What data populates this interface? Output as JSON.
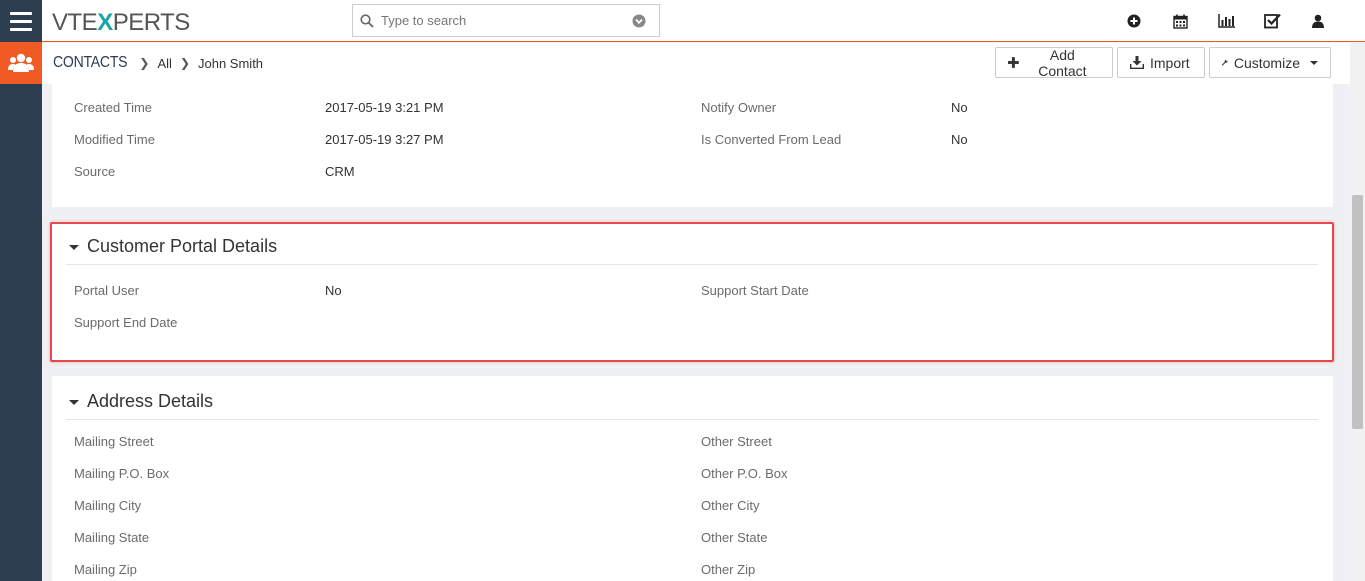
{
  "brand": {
    "logo_prefix": "VTE",
    "logo_x": "X",
    "logo_suffix": "PERTS",
    "accent": "#f15a24",
    "rail_color": "#2d3e50",
    "highlight": "#e8474c"
  },
  "header": {
    "search_placeholder": "Type to search",
    "icons": [
      "add-circle-icon",
      "calendar-icon",
      "bar-chart-icon",
      "checkbox-icon",
      "user-icon"
    ]
  },
  "breadcrumb": {
    "module": "CONTACTS",
    "filter": "All",
    "record": "John Smith"
  },
  "actions": {
    "add_contact": "Add Contact",
    "import": "Import",
    "customize": "Customize"
  },
  "system_info": {
    "rows": [
      {
        "label1": "Created Time",
        "value1": "2017-05-19 3:21 PM",
        "label2": "Notify Owner",
        "value2": "No"
      },
      {
        "label1": "Modified Time",
        "value1": "2017-05-19 3:27 PM",
        "label2": "Is Converted From Lead",
        "value2": "No"
      },
      {
        "label1": "Source",
        "value1": "CRM",
        "label2": "",
        "value2": ""
      }
    ]
  },
  "portal_section": {
    "title": "Customer Portal Details",
    "rows": [
      {
        "label1": "Portal User",
        "value1": "No",
        "label2": "Support Start Date",
        "value2": ""
      },
      {
        "label1": "Support End Date",
        "value1": "",
        "label2": "",
        "value2": ""
      }
    ]
  },
  "address_section": {
    "title": "Address Details",
    "rows": [
      {
        "label1": "Mailing Street",
        "label2": "Other Street"
      },
      {
        "label1": "Mailing P.O. Box",
        "label2": "Other P.O. Box"
      },
      {
        "label1": "Mailing City",
        "label2": "Other City"
      },
      {
        "label1": "Mailing State",
        "label2": "Other State"
      },
      {
        "label1": "Mailing Zip",
        "label2": "Other Zip"
      }
    ]
  }
}
